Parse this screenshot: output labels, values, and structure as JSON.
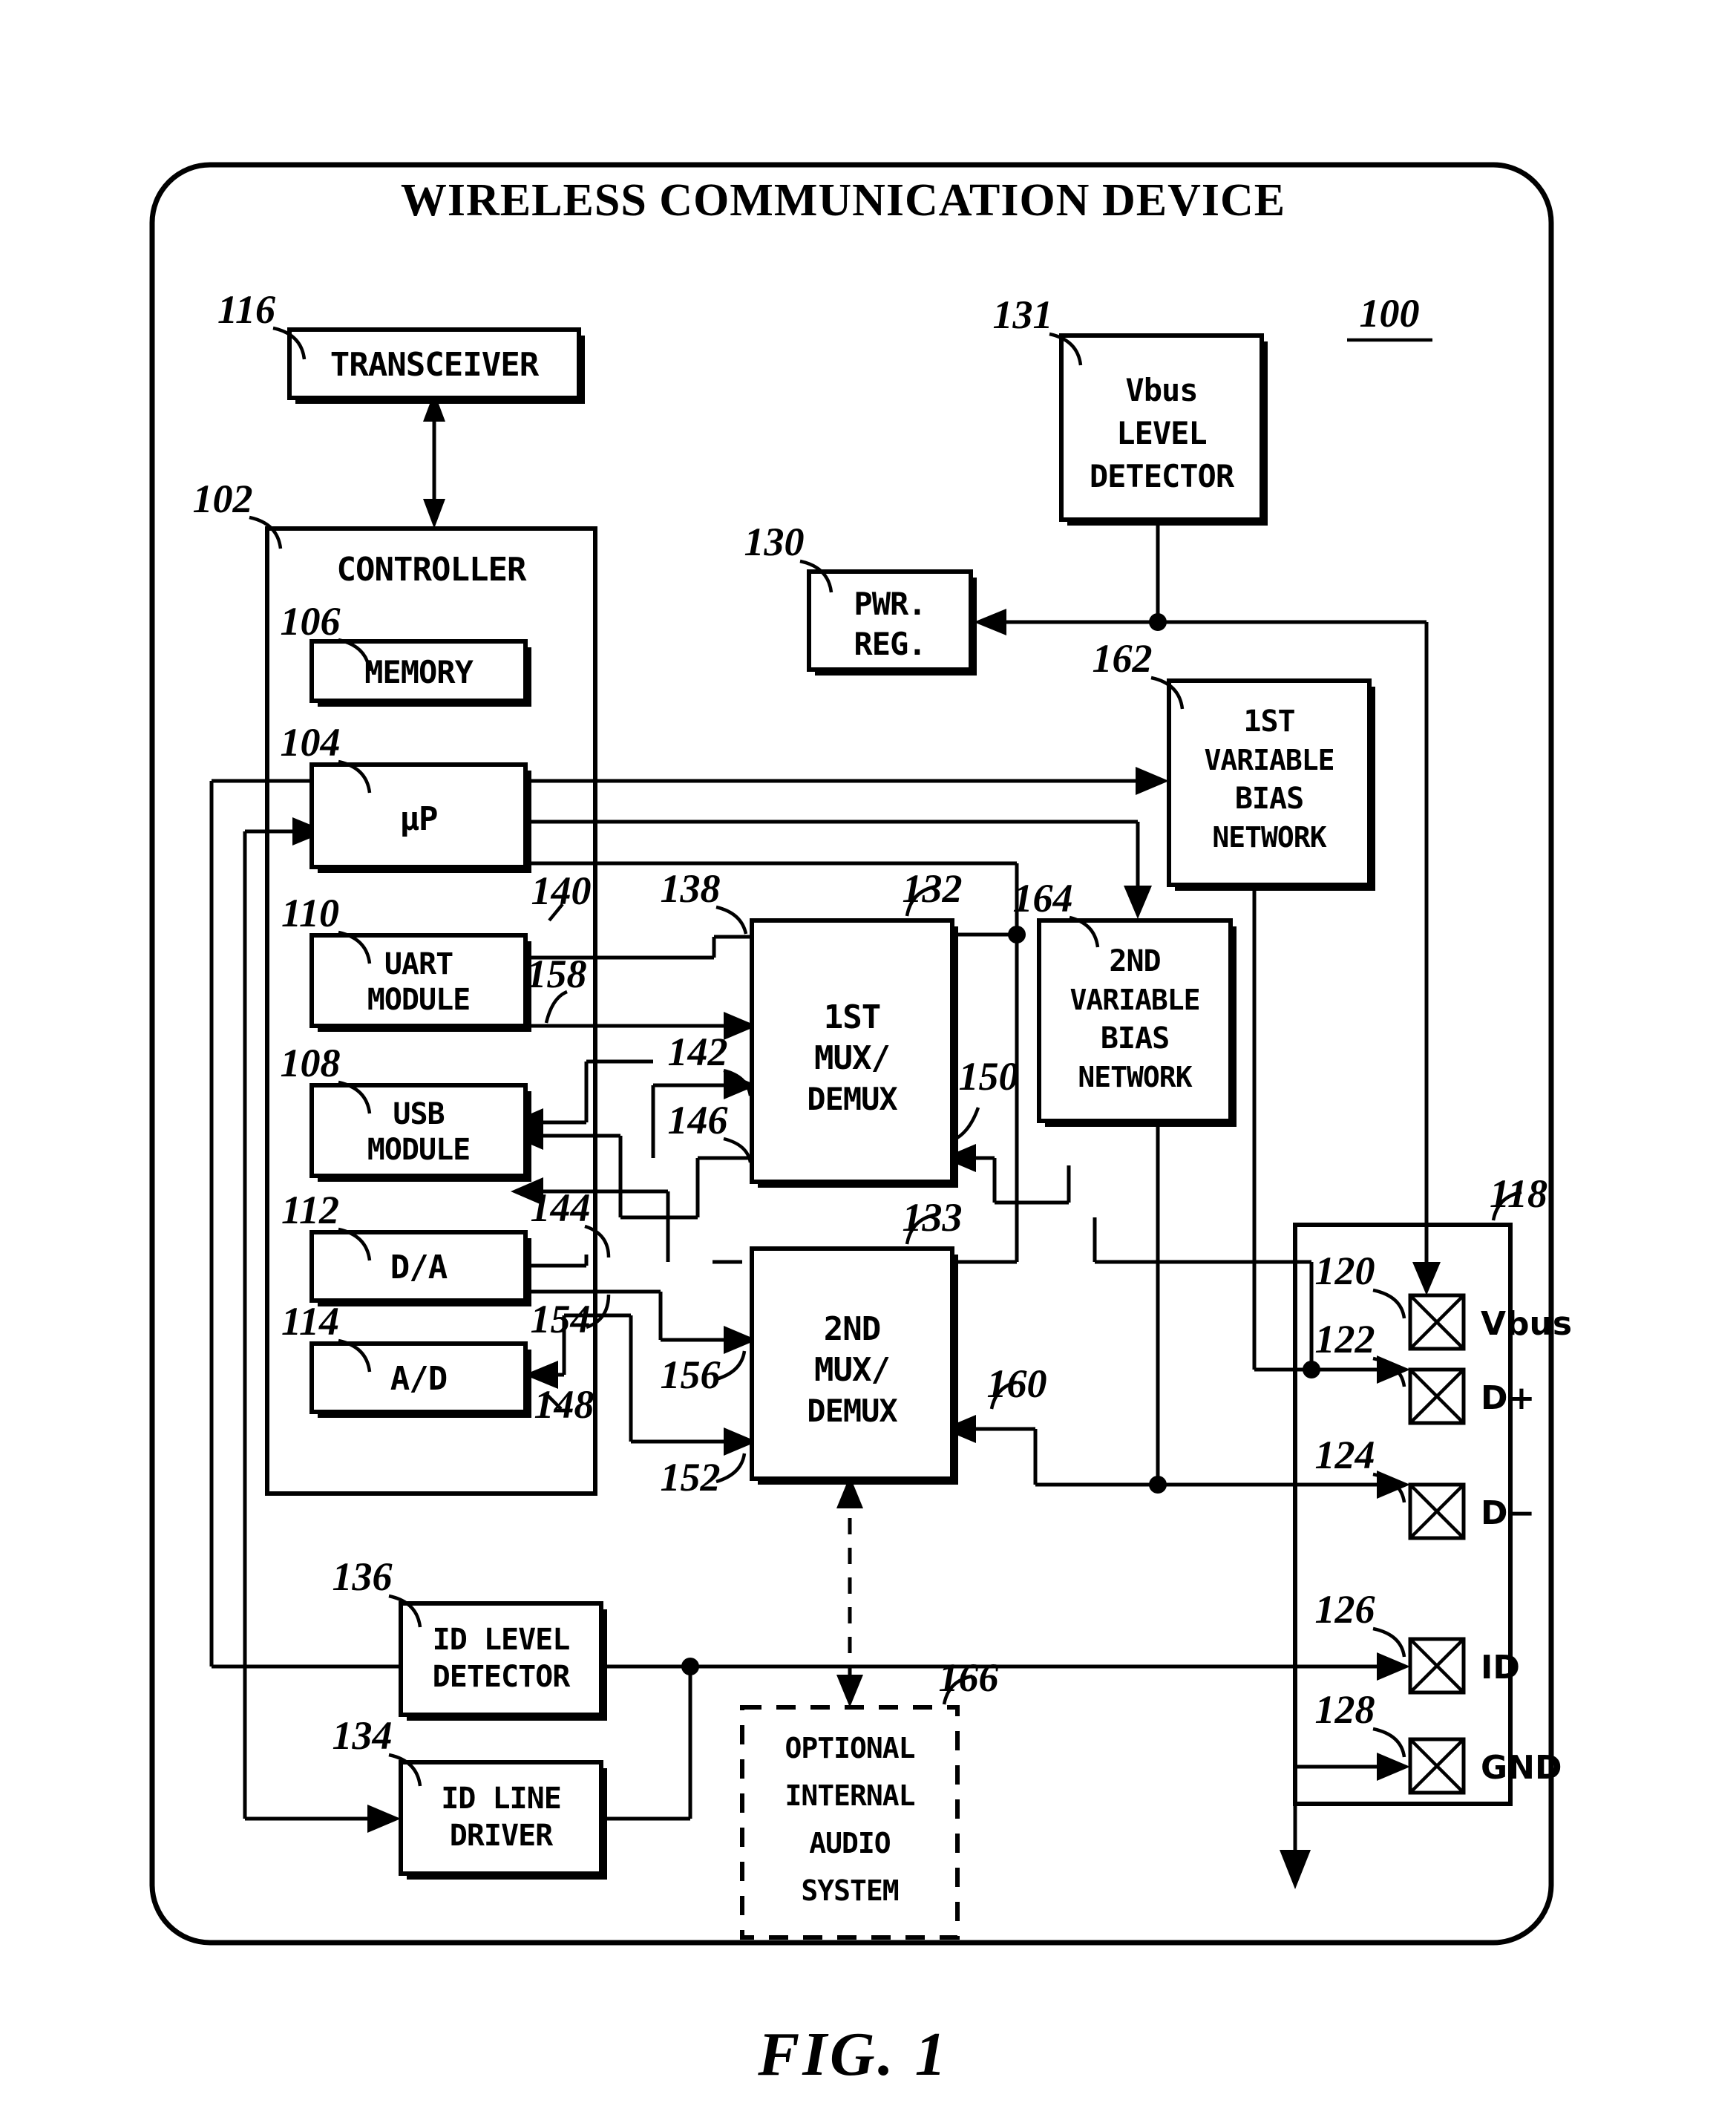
{
  "figure": {
    "caption": "FIG. 1",
    "device_title": "WIRELESS COMMUNICATION DEVICE",
    "device_ref": "100"
  },
  "blocks": {
    "transceiver": {
      "ref": "116",
      "lines": [
        "TRANSCEIVER"
      ]
    },
    "controller": {
      "ref": "102",
      "lines": [
        "CONTROLLER"
      ]
    },
    "memory": {
      "ref": "106",
      "lines": [
        "MEMORY"
      ]
    },
    "microprocessor": {
      "ref": "104",
      "lines": [
        "μP"
      ]
    },
    "uart_module": {
      "ref": "110",
      "lines": [
        "UART",
        "MODULE"
      ]
    },
    "usb_module": {
      "ref": "108",
      "lines": [
        "USB",
        "MODULE"
      ]
    },
    "dac": {
      "ref": "112",
      "lines": [
        "D/A"
      ]
    },
    "adc": {
      "ref": "114",
      "lines": [
        "A/D"
      ]
    },
    "vbus_level_detector": {
      "ref": "131",
      "lines": [
        "Vbus",
        "LEVEL",
        "DETECTOR"
      ]
    },
    "power_regulator": {
      "ref": "130",
      "lines": [
        "PWR.",
        "REG."
      ]
    },
    "first_bias_network": {
      "ref": "162",
      "lines": [
        "1ST",
        "VARIABLE",
        "BIAS",
        "NETWORK"
      ]
    },
    "second_bias_network": {
      "ref": "164",
      "lines": [
        "2ND",
        "VARIABLE",
        "BIAS",
        "NETWORK"
      ]
    },
    "first_mux_demux": {
      "ref": "132",
      "lines": [
        "1ST",
        "MUX/",
        "DEMUX"
      ]
    },
    "second_mux_demux": {
      "ref": "133",
      "lines": [
        "2ND",
        "MUX/",
        "DEMUX"
      ]
    },
    "id_level_detector": {
      "ref": "136",
      "lines": [
        "ID LEVEL",
        "DETECTOR"
      ]
    },
    "id_line_driver": {
      "ref": "134",
      "lines": [
        "ID LINE",
        "DRIVER"
      ]
    },
    "optional_audio": {
      "ref": "166",
      "lines": [
        "OPTIONAL",
        "INTERNAL",
        "AUDIO",
        "SYSTEM"
      ]
    }
  },
  "connector": {
    "ref": "118",
    "pins": [
      {
        "ref": "120",
        "label": "Vbus"
      },
      {
        "ref": "122",
        "label": "D+"
      },
      {
        "ref": "124",
        "label": "D−"
      },
      {
        "ref": "126",
        "label": "ID"
      },
      {
        "ref": "128",
        "label": "GND"
      }
    ]
  },
  "signal_refs": {
    "uart_in": "140",
    "uart_out": "158",
    "mux1_in_138": "138",
    "mux1_in_142": "142",
    "mux1_in_146": "146",
    "mux1_in_150": "150",
    "dac_out": "144",
    "adc_in": "148",
    "adc_ref_154": "154",
    "mux2_in_152": "152",
    "mux2_in_156": "156",
    "mux2_in_160": "160"
  }
}
